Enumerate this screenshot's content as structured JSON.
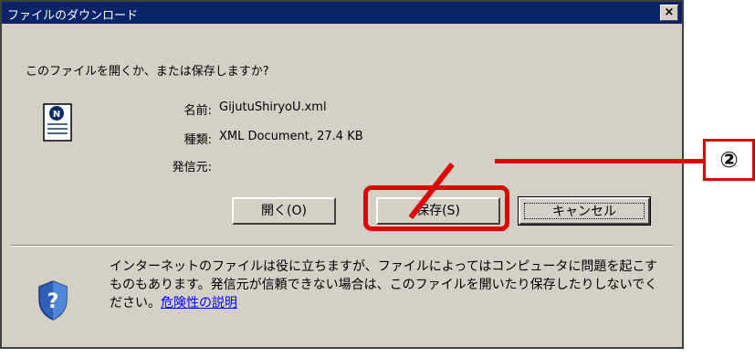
{
  "window": {
    "title": "ファイルのダウンロード",
    "close_label": "×"
  },
  "question": "このファイルを開くか、または保存しますか?",
  "file": {
    "name_label": "名前:",
    "name_value": "GijutuShiryoU.xml",
    "type_label": "種類:",
    "type_value": "XML Document, 27.4 KB",
    "from_label": "発信元:",
    "from_value": ""
  },
  "buttons": {
    "open": "開く(O)",
    "save": "保存(S)",
    "cancel": "キャンセル"
  },
  "notice": {
    "text": "インターネットのファイルは役に立ちますが、ファイルによってはコンピュータに問題を起こすものもあります。発信元が信頼できない場合は、このファイルを開いたり保存したりしないでください。",
    "link": "危険性の説明"
  },
  "callout": {
    "label": "②"
  },
  "colors": {
    "titlebar": "#0a246a",
    "dialog": "#d4d0c8",
    "annotation": "#e00000",
    "link": "#0000ff"
  }
}
